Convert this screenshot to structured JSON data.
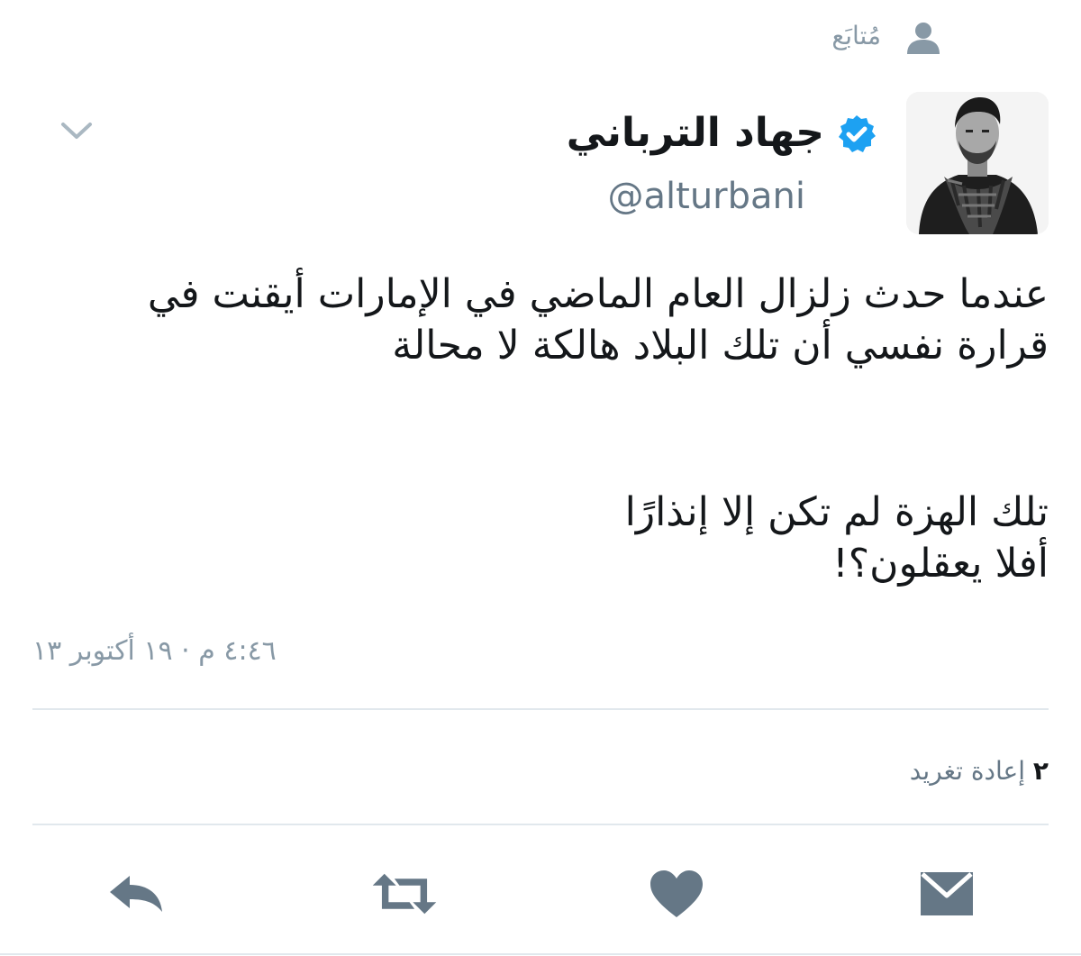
{
  "header": {
    "following_label": "مُتابَع"
  },
  "user": {
    "display_name": "جهاد الترباني",
    "handle": "@alturbani",
    "verified": true
  },
  "tweet": {
    "lines": [
      "عندما حدث زلزال العام الماضي في الإمارات أيقنت في",
      "قرارة نفسي أن تلك البلاد هالكة لا محالة",
      "تلك الهزة لم تكن إلا إنذارًا",
      "أفلا يعقلون؟!"
    ],
    "timestamp": "٤:٤٦ م · ١٩ أكتوبر ١٣"
  },
  "stats": {
    "retweet_count": "٢",
    "retweet_label": "إعادة تغريد"
  },
  "actions": {
    "reply_icon": "reply-icon",
    "retweet_icon": "retweet-icon",
    "like_icon": "heart-icon",
    "message_icon": "envelope-icon"
  },
  "colors": {
    "verified_blue": "#1da1f2",
    "icon_gray": "#657786",
    "muted_text": "#8899a6",
    "divider": "#e1e8ed"
  }
}
